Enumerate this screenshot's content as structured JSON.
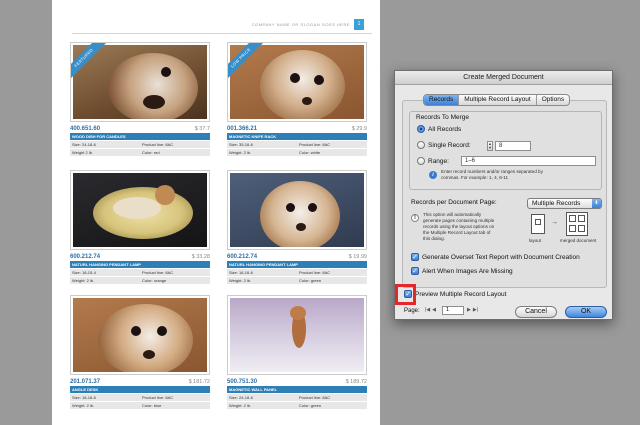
{
  "catalog": {
    "slogan": "COMPANY NAME OR SLOGAN GOES HERE",
    "page_number": "1",
    "products": [
      {
        "ribbon": "FEATURED",
        "sku": "400.651.60",
        "price": "$ 37.7",
        "title": "WOOD DISH FOR CANDLES",
        "size": "Size: 24-18-6",
        "product_line": "Product line: 8AC",
        "weight": "Weight 2 lb.",
        "color": "Color: red"
      },
      {
        "ribbon": "LOW PRICE",
        "sku": "001.366.21",
        "price": "$ 29.9",
        "title": "MAGNETIC KNIFE RACK",
        "size": "Size: 35-16-6",
        "product_line": "Product line: 8AC",
        "weight": "Weight: 2 lb.",
        "color": "Color: white"
      },
      {
        "ribbon": "",
        "sku": "600.212.74",
        "price": "$ 33.28",
        "title": "NATURL HANGING PENDANT LAMP",
        "size": "Size: 18-15-4",
        "product_line": "Product line: 8AC",
        "weight": "Weight: 2 lb.",
        "color": "Color: orange"
      },
      {
        "ribbon": "",
        "sku": "600.212.74",
        "price": "$ 19.99",
        "title": "NATURL HANGING PENDANT LAMP",
        "size": "Size: 16-16-6",
        "product_line": "Product line: 8AC",
        "weight": "Weight: 2 lb.",
        "color": "Color: green"
      },
      {
        "ribbon": "",
        "sku": "201.071.37",
        "price": "$ 181.72",
        "title": "ANGLE DESK",
        "size": "Size: 18-18-6",
        "product_line": "Product line: 8AC",
        "weight": "Weight: 2 lb.",
        "color": "Color: blue"
      },
      {
        "ribbon": "",
        "sku": "500.751.30",
        "price": "$ 189.72",
        "title": "MAGNETIC WALL PANEL",
        "size": "Size: 24-18-6",
        "product_line": "Product line: 8AC",
        "weight": "Weight: 2 lb.",
        "color": "Color: green"
      }
    ]
  },
  "dialog": {
    "title": "Create Merged Document",
    "tabs": [
      {
        "label": "Records"
      },
      {
        "label": "Multiple Record Layout"
      },
      {
        "label": "Options"
      }
    ],
    "records_group_title": "Records To Merge",
    "all_records_label": "All Records",
    "single_record_label": "Single Record:",
    "single_record_value": "8",
    "range_label": "Range:",
    "range_value": "1–6",
    "range_hint_line1": "Enter record numbers and/or ranges separated by",
    "range_hint_line2": "commas. For example: 1, 4, 6-11",
    "records_per_page_label": "Records per Document Page:",
    "records_per_page_value": "Multiple Records",
    "info_line1": "This option will automatically",
    "info_line2": "generate pages containing multiple",
    "info_line3": "records using the layout options on",
    "info_line4": "the Multiple Record Layout tab of",
    "info_line5": "this dialog.",
    "layout_caption": "layout",
    "merged_caption": "merged document",
    "overset_label": "Generate Overset Text Report with Document Creation",
    "missing_images_label": "Alert When Images Are Missing",
    "preview_label": "Preview Multiple Record Layout",
    "page_label": "Page:",
    "page_value": "1",
    "cancel_label": "Cancel",
    "ok_label": "OK"
  },
  "colors": {
    "accent": "#3e80d6",
    "highlight": "#e5262a",
    "catalog_blue": "#2e7fb5"
  }
}
